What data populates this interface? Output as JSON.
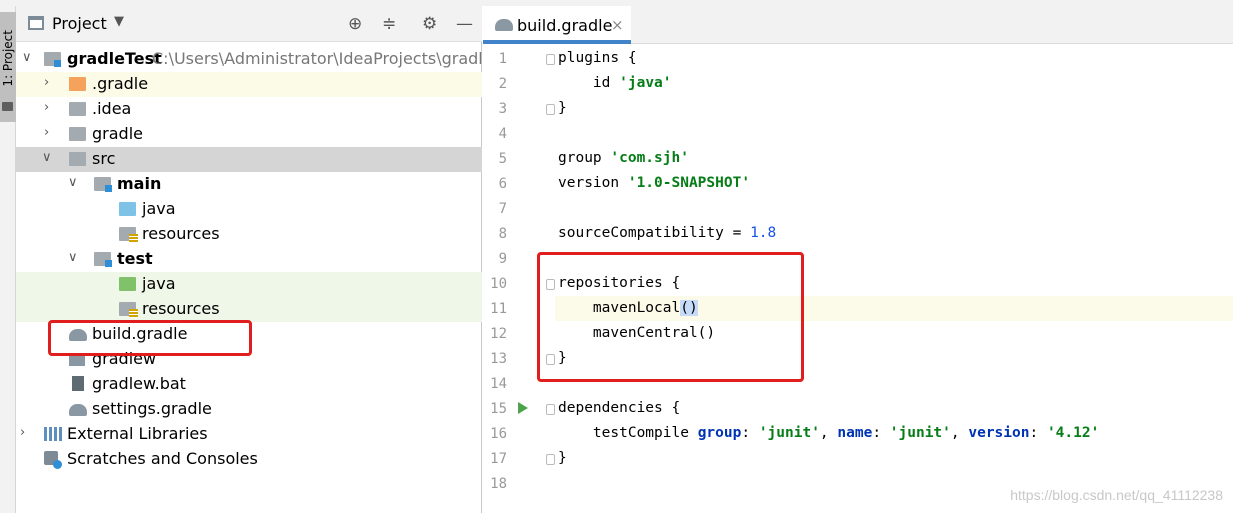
{
  "toolstrip": {
    "project_tab_label": "1: Project"
  },
  "project_pane": {
    "title": "Project",
    "header_icons": [
      "crosshair-icon",
      "collapse-icon",
      "gear-icon",
      "minimize-icon"
    ],
    "tree": [
      {
        "label": "gradleTest",
        "path": "C:\\Users\\Administrator\\IdeaProjects\\gradleTe"
      },
      {
        "label": ".gradle"
      },
      {
        "label": ".idea"
      },
      {
        "label": "gradle"
      },
      {
        "label": "src"
      },
      {
        "label": "main"
      },
      {
        "label": "java"
      },
      {
        "label": "resources"
      },
      {
        "label": "test"
      },
      {
        "label": "java"
      },
      {
        "label": "resources"
      },
      {
        "label": "build.gradle"
      },
      {
        "label": "gradlew"
      },
      {
        "label": "gradlew.bat"
      },
      {
        "label": "settings.gradle"
      },
      {
        "label": "External Libraries"
      },
      {
        "label": "Scratches and Consoles"
      }
    ]
  },
  "editor": {
    "tab_label": "build.gradle",
    "close_glyph": "×",
    "line_numbers": [
      "1",
      "2",
      "3",
      "4",
      "5",
      "6",
      "7",
      "8",
      "9",
      "10",
      "11",
      "12",
      "13",
      "14",
      "15",
      "16",
      "17",
      "18"
    ],
    "code": {
      "l1": "plugins {",
      "l2_id": "id ",
      "l2_val": "'java'",
      "l3": "}",
      "l5_kw": "group ",
      "l5_val": "'com.sjh'",
      "l6_kw": "version ",
      "l6_val": "'1.0-SNAPSHOT'",
      "l8_kw": "sourceCompatibility = ",
      "l8_val": "1.8",
      "l10": "repositories {",
      "l11_name": "mavenLocal",
      "l11_paren": "()",
      "l12": "mavenCentral()",
      "l13": "}",
      "l15": "dependencies {",
      "l16_fn": "testCompile ",
      "l16_k1": "group",
      "l16_sep1": ": ",
      "l16_v1": "'junit'",
      "l16_comma1": ", ",
      "l16_k2": "name",
      "l16_sep2": ": ",
      "l16_v2": "'junit'",
      "l16_comma2": ", ",
      "l16_k3": "version",
      "l16_sep3": ": ",
      "l16_v3": "'4.12'",
      "l17": "}"
    }
  },
  "watermark": "https://blog.csdn.net/qq_41112238",
  "colors": {
    "highlight_box": "#e01e1e",
    "tab_underline": "#4083c9",
    "string": "#067d17",
    "number": "#1750eb"
  }
}
